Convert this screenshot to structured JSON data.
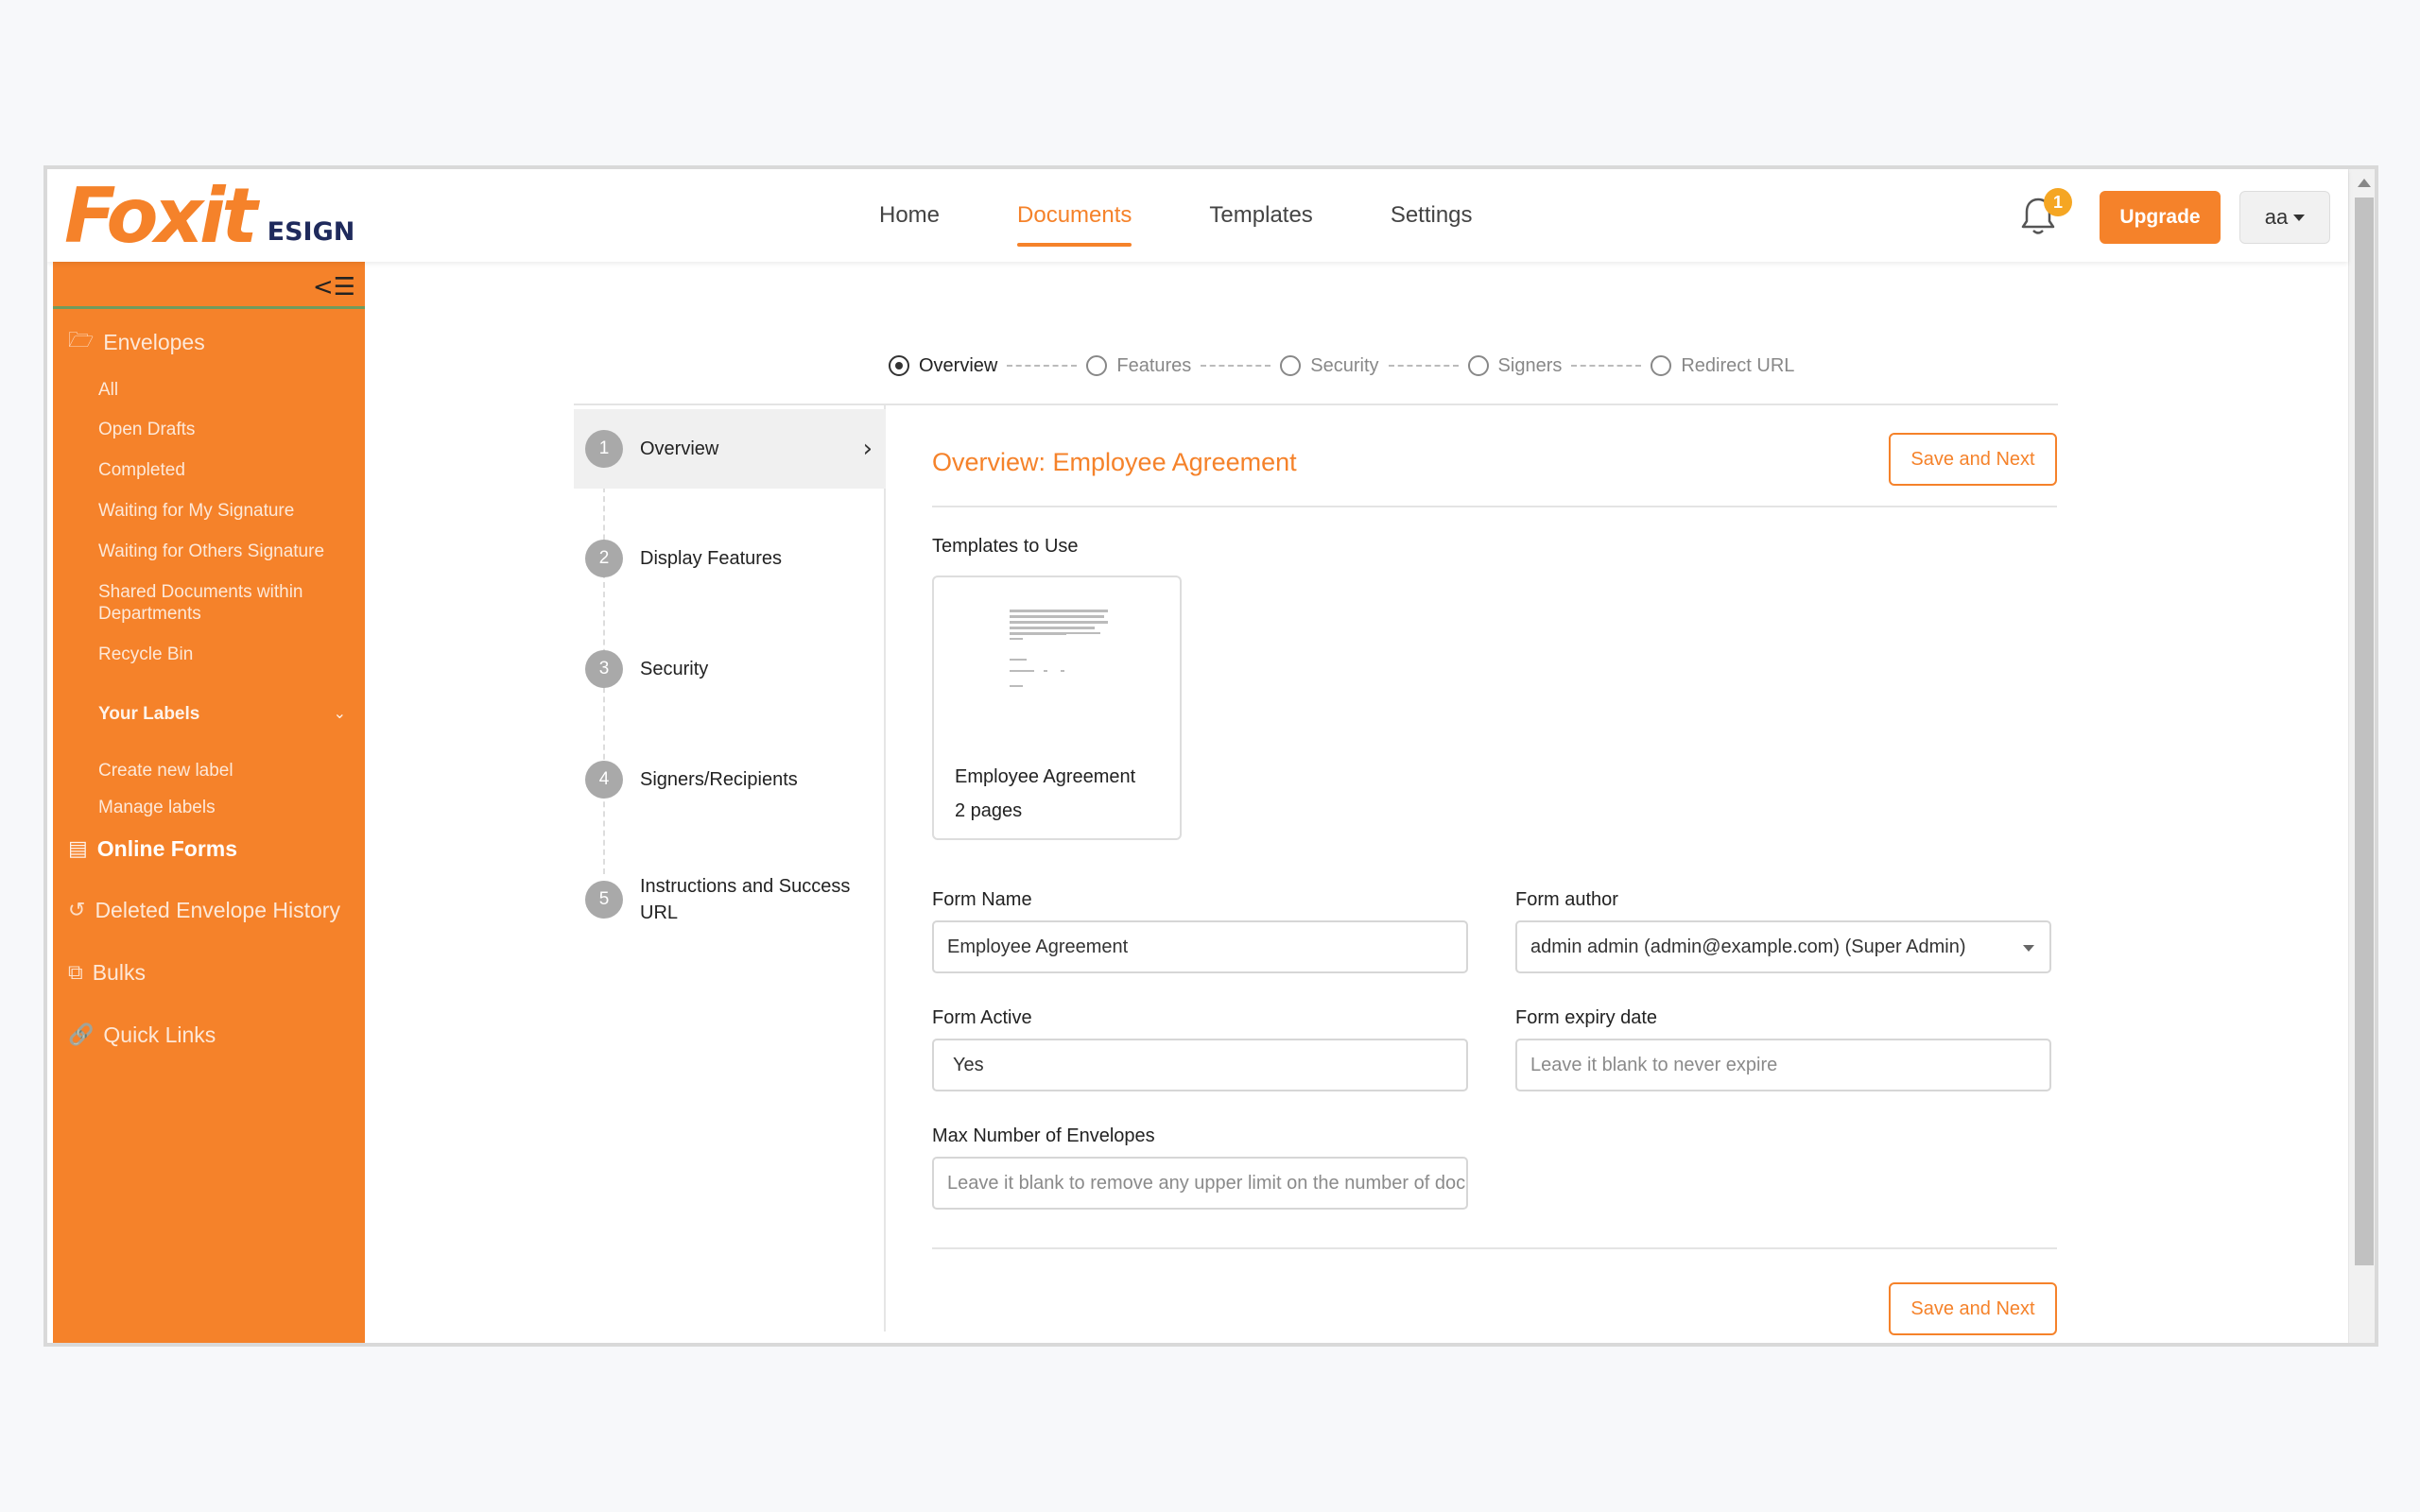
{
  "header": {
    "logo_main": "Foxit",
    "logo_sub": "ESIGN",
    "nav": [
      {
        "label": "Home"
      },
      {
        "label": "Documents"
      },
      {
        "label": "Templates"
      },
      {
        "label": "Settings"
      }
    ],
    "active_nav": "Documents",
    "notification_count": "1",
    "upgrade_label": "Upgrade",
    "user_label": "aa"
  },
  "sidebar": {
    "envelopes_label": "Envelopes",
    "envelope_items": [
      "All",
      "Open Drafts",
      "Completed",
      "Waiting for My Signature",
      "Waiting for Others Signature",
      "Shared Documents within Departments",
      "Recycle Bin"
    ],
    "your_labels": "Your Labels",
    "label_items": [
      "Create new label",
      "Manage labels"
    ],
    "online_forms": "Online Forms",
    "deleted_history": "Deleted Envelope History",
    "bulks": "Bulks",
    "quick_links": "Quick Links"
  },
  "wizard": {
    "top_steps": [
      "Overview",
      "Features",
      "Security",
      "Signers",
      "Redirect URL"
    ],
    "active_step": "Overview",
    "side_steps": [
      {
        "num": "1",
        "label": "Overview"
      },
      {
        "num": "2",
        "label": "Display Features"
      },
      {
        "num": "3",
        "label": "Security"
      },
      {
        "num": "4",
        "label": "Signers/Recipients"
      },
      {
        "num": "5",
        "label": "Instructions and Success URL"
      }
    ]
  },
  "form": {
    "title": "Overview: Employee Agreement",
    "save_next_label": "Save and Next",
    "templates_label": "Templates to Use",
    "template": {
      "name": "Employee Agreement",
      "pages": "2 pages"
    },
    "form_name_label": "Form Name",
    "form_name_value": "Employee Agreement",
    "form_author_label": "Form author",
    "form_author_value": "admin admin (admin@example.com) (Super Admin)",
    "form_active_label": "Form Active",
    "form_active_value": "Yes",
    "form_expiry_label": "Form expiry date",
    "form_expiry_placeholder": "Leave it blank to never expire",
    "max_envelopes_label": "Max Number of Envelopes",
    "max_envelopes_placeholder": "Leave it blank to remove any upper limit on the number of doc"
  },
  "colors": {
    "accent": "#f5822a",
    "sidebar": "#f5822a",
    "badge": "#f5a623"
  }
}
